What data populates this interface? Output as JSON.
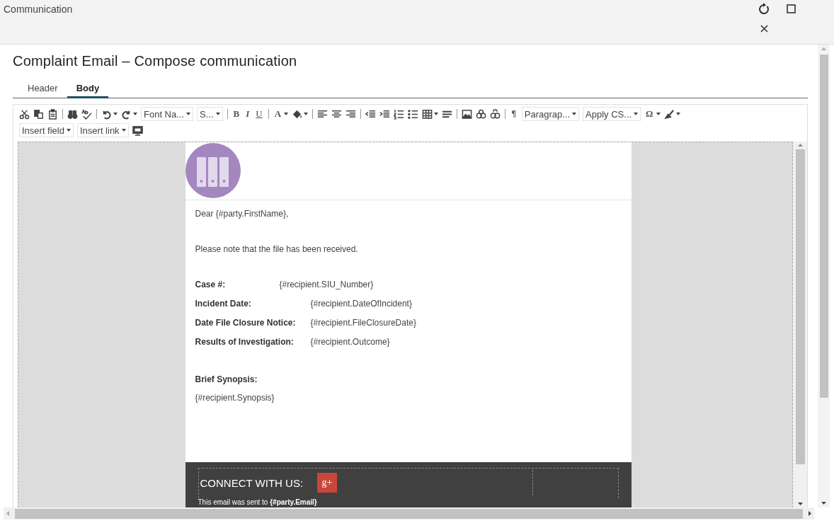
{
  "window": {
    "title": "Communication"
  },
  "heading": "Complaint Email – Compose communication",
  "tabs": [
    {
      "label": "Header",
      "selected": false
    },
    {
      "label": "Body",
      "selected": true
    }
  ],
  "toolbar": {
    "dropdowns": [
      "Font Na...",
      "S...",
      "Paragrap...",
      "Apply CS...",
      "Insert field",
      "Insert link"
    ],
    "glyphs": [
      "B",
      "I",
      "U",
      "A",
      "¶",
      "Ω"
    ]
  },
  "email": {
    "greeting": "Dear {#party.FirstName},",
    "message": "Please note that the file has been received.",
    "fields": [
      {
        "label": "Case #:",
        "value": "{#recipient.SIU_Number}"
      },
      {
        "label": "Incident Date:",
        "value": "{#recipient.DateOfIncident}"
      },
      {
        "label": "Date File Closure Notice:",
        "value": "{#recipient.FileClosureDate}"
      },
      {
        "label": "Results of Investigation:",
        "value": "{#recipient.Outcome}"
      }
    ],
    "synopsis_label": "Brief Synopsis:",
    "synopsis": "{#recipient.Synopsis}",
    "footer": {
      "connect": "CONNECT WITH US:",
      "social": "g+",
      "sent_to": "This email was sent to **{#party.Email}**"
    }
  }
}
